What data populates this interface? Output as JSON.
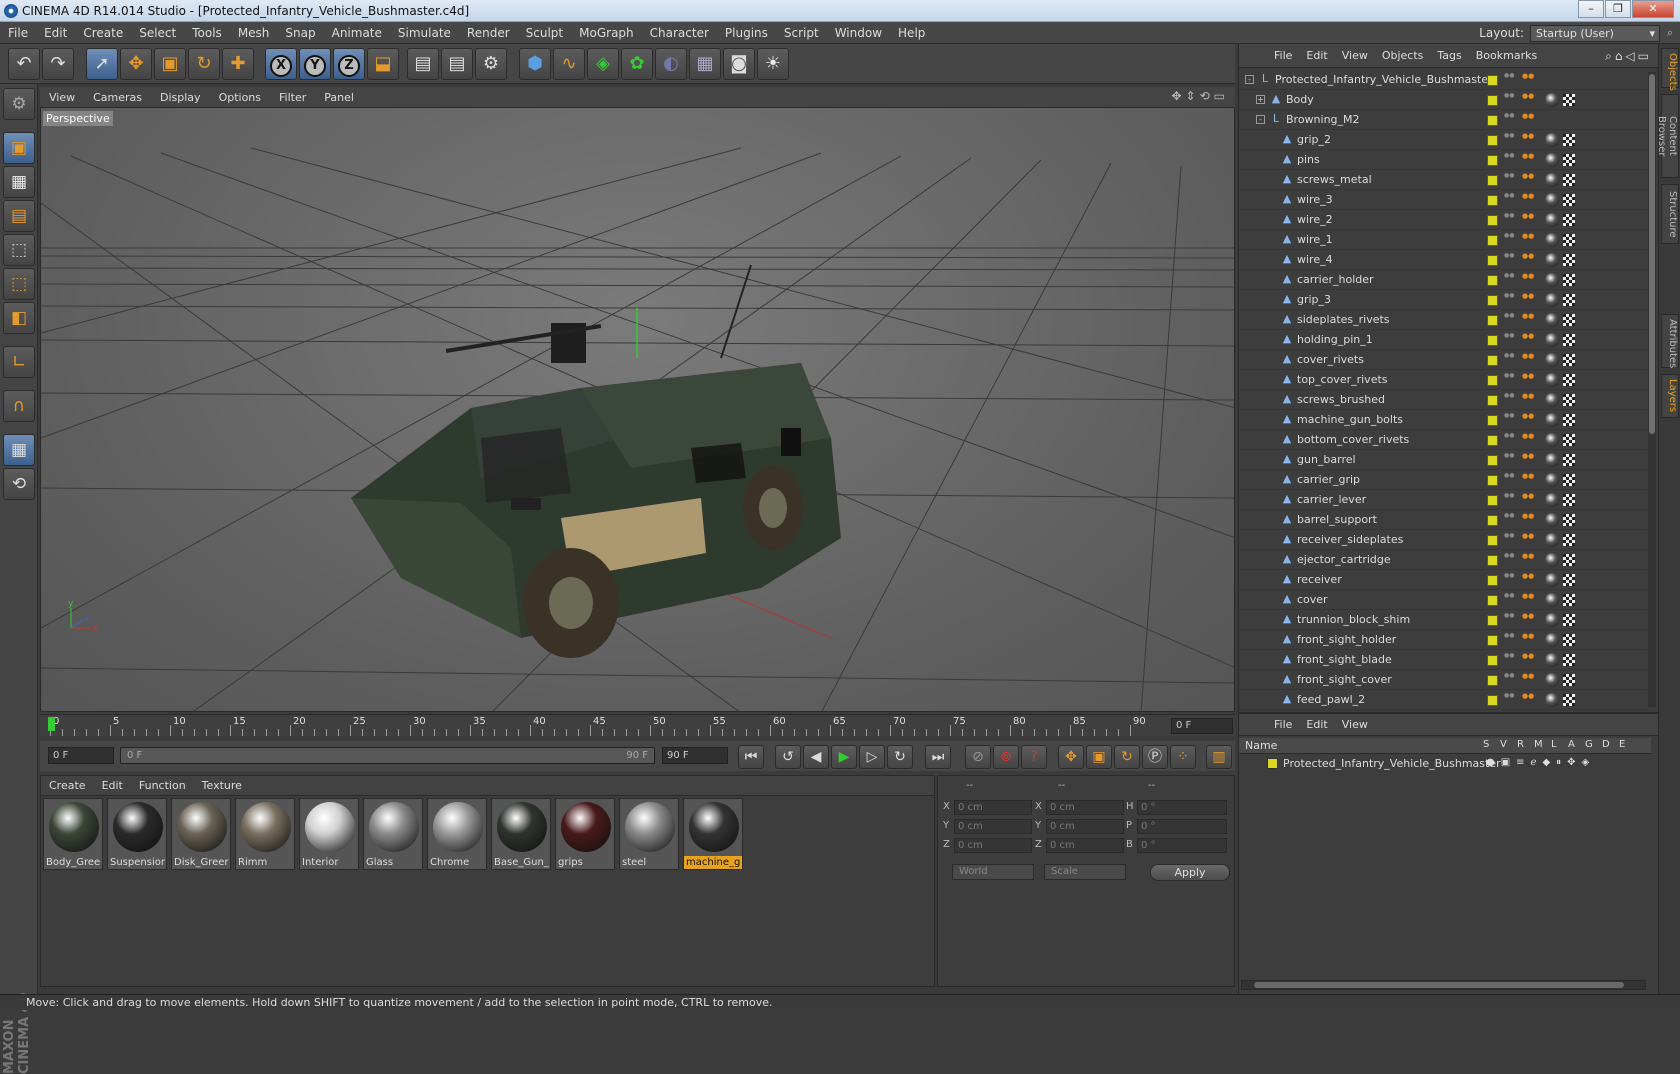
{
  "window": {
    "title": "CINEMA 4D R14.014 Studio - [Protected_Infantry_Vehicle_Bushmaster.c4d]",
    "buttons": [
      "–",
      "❐",
      "✕"
    ]
  },
  "menu": [
    "File",
    "Edit",
    "Create",
    "Select",
    "Tools",
    "Mesh",
    "Snap",
    "Animate",
    "Simulate",
    "Render",
    "Sculpt",
    "MoGraph",
    "Character",
    "Plugins",
    "Script",
    "Window",
    "Help"
  ],
  "layout": {
    "label": "Layout:",
    "value": "Startup (User)"
  },
  "toolbar": {
    "icons": [
      "undo-icon",
      "redo-icon",
      "live-selection-icon",
      "move-icon",
      "scale-icon",
      "rotate-icon",
      "add-object-icon",
      "x-axis-icon",
      "y-axis-icon",
      "z-axis-icon",
      "coordinate-system-icon",
      "render-view-icon",
      "render-picture-viewer-icon",
      "render-settings-icon",
      "cube-icon",
      "spline-icon",
      "nurbs-icon",
      "array-icon",
      "deformer-icon",
      "floor-icon",
      "camera-icon",
      "light-icon"
    ],
    "axis_labels": [
      "X",
      "Y",
      "Z"
    ]
  },
  "viewport": {
    "menu": [
      "View",
      "Cameras",
      "Display",
      "Options",
      "Filter",
      "Panel"
    ],
    "label": "Perspective"
  },
  "timeline": {
    "labels": [
      "0",
      "5",
      "10",
      "15",
      "20",
      "25",
      "30",
      "35",
      "40",
      "45",
      "50",
      "55",
      "60",
      "65",
      "70",
      "75",
      "80",
      "85",
      "90"
    ],
    "current_frame": "0 F",
    "current": 0,
    "max": 90
  },
  "transport": {
    "start_field": "0 F",
    "slider_start": "0 F",
    "slider_end": "90 F",
    "end_field": "90 F"
  },
  "materials": {
    "menu": [
      "Create",
      "Edit",
      "Function",
      "Texture"
    ],
    "items": [
      {
        "name": "Body_Gree",
        "color": "#3c4538"
      },
      {
        "name": "Suspensior",
        "color": "#2a2a2a"
      },
      {
        "name": "Disk_Greer",
        "color": "#6a6355"
      },
      {
        "name": "Rimm",
        "color": "#7a7060"
      },
      {
        "name": "Interior",
        "color": "#d0d0d0"
      },
      {
        "name": "Glass",
        "color": "#8a8a8a"
      },
      {
        "name": "Chrome",
        "color": "#9a9a9a"
      },
      {
        "name": "Base_Gun_",
        "color": "#2f352e"
      },
      {
        "name": "grips",
        "color": "#4a1a1a"
      },
      {
        "name": "steel",
        "color": "#8b8b8b"
      },
      {
        "name": "machine_g",
        "color": "#333333"
      }
    ],
    "selected": "machine_g"
  },
  "coordinates": {
    "headers": [
      "--",
      "--",
      "--"
    ],
    "rows": [
      {
        "a": "X",
        "av": "0 cm",
        "b": "X",
        "bv": "0 cm",
        "c": "H",
        "cv": "0 °"
      },
      {
        "a": "Y",
        "av": "0 cm",
        "b": "Y",
        "bv": "0 cm",
        "c": "P",
        "cv": "0 °"
      },
      {
        "a": "Z",
        "av": "0 cm",
        "b": "Z",
        "bv": "0 cm",
        "c": "B",
        "cv": "0 °"
      }
    ],
    "mode": "World",
    "transform": "Scale",
    "apply": "Apply"
  },
  "objects": {
    "menu": [
      "File",
      "Edit",
      "View",
      "Objects",
      "Tags",
      "Bookmarks"
    ],
    "items": [
      {
        "name": "Protected_Infantry_Vehicle_Bushmaster",
        "level": 0,
        "type": "null",
        "expand": "-",
        "tags": false
      },
      {
        "name": "Body",
        "level": 1,
        "type": "poly",
        "expand": "+",
        "tags": true
      },
      {
        "name": "Browning_M2",
        "level": 1,
        "type": "null",
        "expand": "-",
        "tags": false
      },
      {
        "name": "grip_2",
        "level": 2,
        "type": "poly",
        "tags": true
      },
      {
        "name": "pins",
        "level": 2,
        "type": "poly",
        "tags": true
      },
      {
        "name": "screws_metal",
        "level": 2,
        "type": "poly",
        "tags": true
      },
      {
        "name": "wire_3",
        "level": 2,
        "type": "poly",
        "tags": true
      },
      {
        "name": "wire_2",
        "level": 2,
        "type": "poly",
        "tags": true
      },
      {
        "name": "wire_1",
        "level": 2,
        "type": "poly",
        "tags": true
      },
      {
        "name": "wire_4",
        "level": 2,
        "type": "poly",
        "tags": true
      },
      {
        "name": "carrier_holder",
        "level": 2,
        "type": "poly",
        "tags": true
      },
      {
        "name": "grip_3",
        "level": 2,
        "type": "poly",
        "tags": true
      },
      {
        "name": "sideplates_rivets",
        "level": 2,
        "type": "poly",
        "tags": true
      },
      {
        "name": "holding_pin_1",
        "level": 2,
        "type": "poly",
        "tags": true
      },
      {
        "name": "cover_rivets",
        "level": 2,
        "type": "poly",
        "tags": true
      },
      {
        "name": "top_cover_rivets",
        "level": 2,
        "type": "poly",
        "tags": true
      },
      {
        "name": "screws_brushed",
        "level": 2,
        "type": "poly",
        "tags": true
      },
      {
        "name": "machine_gun_bolts",
        "level": 2,
        "type": "poly",
        "tags": true
      },
      {
        "name": "bottom_cover_rivets",
        "level": 2,
        "type": "poly",
        "tags": true
      },
      {
        "name": "gun_barrel",
        "level": 2,
        "type": "poly",
        "tags": true
      },
      {
        "name": "carrier_grip",
        "level": 2,
        "type": "poly",
        "tags": true
      },
      {
        "name": "carrier_lever",
        "level": 2,
        "type": "poly",
        "tags": true
      },
      {
        "name": "barrel_support",
        "level": 2,
        "type": "poly",
        "tags": true
      },
      {
        "name": "receiver_sideplates",
        "level": 2,
        "type": "poly",
        "tags": true
      },
      {
        "name": "ejector_cartridge",
        "level": 2,
        "type": "poly",
        "tags": true
      },
      {
        "name": "receiver",
        "level": 2,
        "type": "poly",
        "tags": true
      },
      {
        "name": "cover",
        "level": 2,
        "type": "poly",
        "tags": true
      },
      {
        "name": "trunnion_block_shim",
        "level": 2,
        "type": "poly",
        "tags": true
      },
      {
        "name": "front_sight_holder",
        "level": 2,
        "type": "poly",
        "tags": true
      },
      {
        "name": "front_sight_blade",
        "level": 2,
        "type": "poly",
        "tags": true
      },
      {
        "name": "front_sight_cover",
        "level": 2,
        "type": "poly",
        "tags": true
      },
      {
        "name": "feed_pawl_2",
        "level": 2,
        "type": "poly",
        "tags": true
      }
    ]
  },
  "layers": {
    "menu": [
      "File",
      "Edit",
      "View"
    ],
    "header_name": "Name",
    "columns": [
      "S",
      "V",
      "R",
      "M",
      "L",
      "A",
      "G",
      "D",
      "E"
    ],
    "rows": [
      {
        "name": "Protected_Infantry_Vehicle_Bushmaster"
      }
    ]
  },
  "side_tabs": [
    "Objects",
    "Content Browser",
    "Structure",
    "Attributes",
    "Layers"
  ],
  "maxon": "MAXON CINEMA 4D",
  "status": "Move: Click and drag to move elements. Hold down SHIFT to quantize movement / add to the selection in point mode, CTRL to remove."
}
